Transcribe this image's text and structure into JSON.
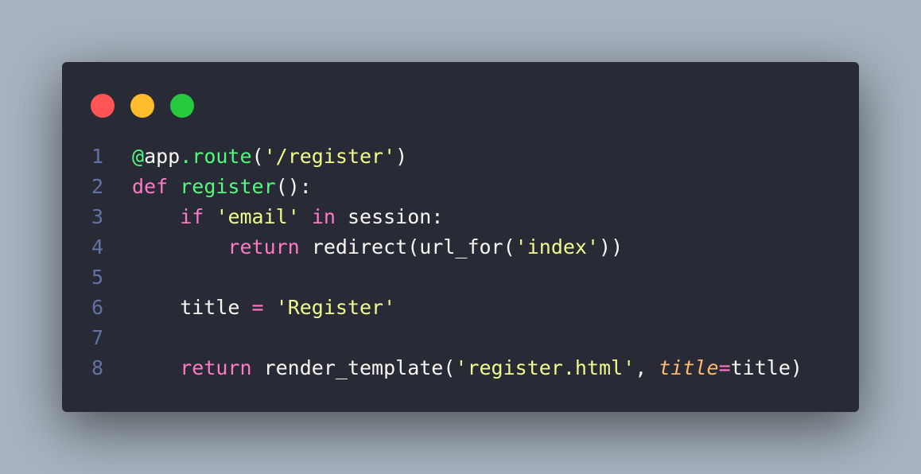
{
  "window": {
    "controls": [
      {
        "name": "close-dot",
        "color": "#ff5555"
      },
      {
        "name": "minimize-dot",
        "color": "#ffbd2e"
      },
      {
        "name": "maximize-dot",
        "color": "#27c93f"
      }
    ]
  },
  "colors": {
    "background": "#a7b3bf",
    "editor": "#282a36",
    "line_number": "#6272a4",
    "plain": "#f8f8f2",
    "keyword": "#ff79c6",
    "function": "#50fa7b",
    "string": "#f1fa8c",
    "param": "#ffb86c"
  },
  "code": {
    "lines": [
      {
        "number": "1",
        "tokens": [
          {
            "text": "@",
            "color": "#50fa7b"
          },
          {
            "text": "app",
            "color": "#f8f8f2"
          },
          {
            "text": ".route",
            "color": "#50fa7b"
          },
          {
            "text": "(",
            "color": "#f8f8f2"
          },
          {
            "text": "'/register'",
            "color": "#f1fa8c"
          },
          {
            "text": ")",
            "color": "#f8f8f2"
          }
        ]
      },
      {
        "number": "2",
        "tokens": [
          {
            "text": "def",
            "color": "#ff79c6"
          },
          {
            "text": " ",
            "color": "#f8f8f2"
          },
          {
            "text": "register",
            "color": "#50fa7b"
          },
          {
            "text": "():",
            "color": "#f8f8f2"
          }
        ]
      },
      {
        "number": "3",
        "tokens": [
          {
            "text": "    ",
            "color": "#f8f8f2"
          },
          {
            "text": "if",
            "color": "#ff79c6"
          },
          {
            "text": " ",
            "color": "#f8f8f2"
          },
          {
            "text": "'email'",
            "color": "#f1fa8c"
          },
          {
            "text": " ",
            "color": "#f8f8f2"
          },
          {
            "text": "in",
            "color": "#ff79c6"
          },
          {
            "text": " session:",
            "color": "#f8f8f2"
          }
        ]
      },
      {
        "number": "4",
        "tokens": [
          {
            "text": "        ",
            "color": "#f8f8f2"
          },
          {
            "text": "return",
            "color": "#ff79c6"
          },
          {
            "text": " redirect(url_for(",
            "color": "#f8f8f2"
          },
          {
            "text": "'index'",
            "color": "#f1fa8c"
          },
          {
            "text": "))",
            "color": "#f8f8f2"
          }
        ]
      },
      {
        "number": "5",
        "tokens": []
      },
      {
        "number": "6",
        "tokens": [
          {
            "text": "    title ",
            "color": "#f8f8f2"
          },
          {
            "text": "=",
            "color": "#ff79c6"
          },
          {
            "text": " ",
            "color": "#f8f8f2"
          },
          {
            "text": "'Register'",
            "color": "#f1fa8c"
          }
        ]
      },
      {
        "number": "7",
        "tokens": []
      },
      {
        "number": "8",
        "tokens": [
          {
            "text": "    ",
            "color": "#f8f8f2"
          },
          {
            "text": "return",
            "color": "#ff79c6"
          },
          {
            "text": " render_template(",
            "color": "#f8f8f2"
          },
          {
            "text": "'register.html'",
            "color": "#f1fa8c"
          },
          {
            "text": ", ",
            "color": "#f8f8f2"
          },
          {
            "text": "title",
            "color": "#ffb86c",
            "italic": true
          },
          {
            "text": "=",
            "color": "#ff79c6"
          },
          {
            "text": "title)",
            "color": "#f8f8f2"
          }
        ]
      }
    ]
  }
}
